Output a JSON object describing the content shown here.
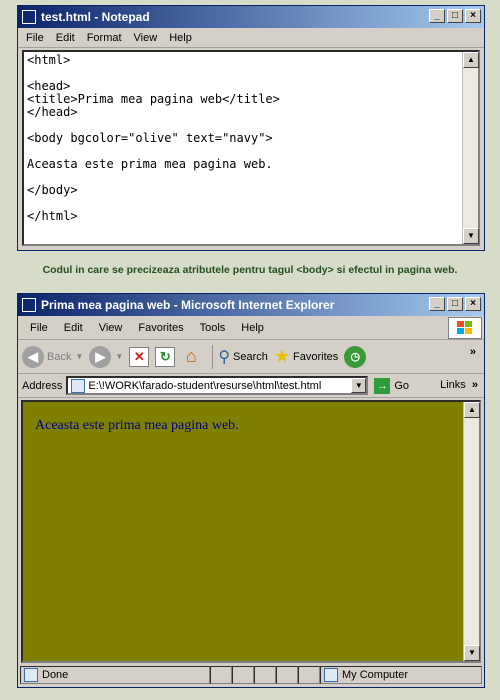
{
  "notepad": {
    "title": "test.html - Notepad",
    "menus": [
      "File",
      "Edit",
      "Format",
      "View",
      "Help"
    ],
    "content": "<html>\n\n<head>\n<title>Prima mea pagina web</title>\n</head>\n\n<body bgcolor=\"olive\" text=\"navy\">\n\nAceasta este prima mea pagina web.\n\n</body>\n\n</html>"
  },
  "caption": "Codul in care se precizeaza atributele pentru tagul <body> si efectul in pagina web.",
  "ie": {
    "title": "Prima mea pagina web - Microsoft Internet Explorer",
    "menus": [
      "File",
      "Edit",
      "View",
      "Favorites",
      "Tools",
      "Help"
    ],
    "toolbar": {
      "back": "Back",
      "search": "Search",
      "favorites": "Favorites"
    },
    "address": {
      "label": "Address",
      "value": "E:\\!WORK\\farado-student\\resurse\\html\\test.html",
      "go": "Go",
      "links": "Links"
    },
    "page": {
      "bgcolor": "#808000",
      "textcolor": "#000080",
      "text": "Aceasta este prima mea pagina web."
    },
    "status": {
      "left": "Done",
      "zone": "My Computer"
    }
  }
}
